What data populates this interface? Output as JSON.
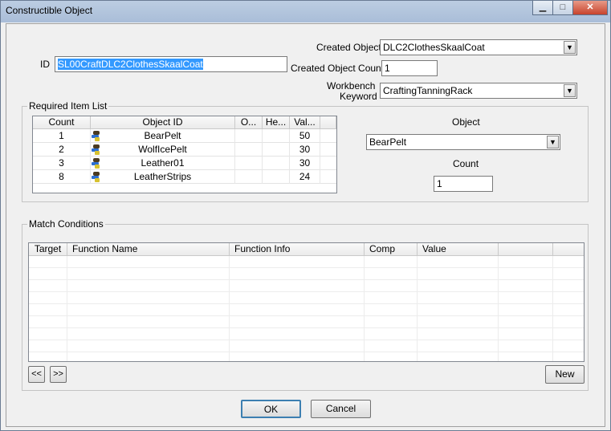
{
  "window": {
    "title": "Constructible Object"
  },
  "form": {
    "id_label": "ID",
    "id_value": "SL00CraftDLC2ClothesSkaalCoat",
    "created_object_label": "Created Object",
    "created_object_value": "DLC2ClothesSkaalCoat",
    "created_object_count_label": "Created Object Count",
    "created_object_count_value": "1",
    "workbench_label_line1": "Workbench",
    "workbench_label_line2": "Keyword",
    "workbench_value": "CraftingTanningRack"
  },
  "required_items": {
    "group_title": "Required Item List",
    "columns": [
      "Count",
      "Object ID",
      "O...",
      "He...",
      "Val..."
    ],
    "rows": [
      {
        "count": "1",
        "object_id": "BearPelt",
        "o": "",
        "he": "",
        "val": "50"
      },
      {
        "count": "2",
        "object_id": "WolfIcePelt",
        "o": "",
        "he": "",
        "val": "30"
      },
      {
        "count": "3",
        "object_id": "Leather01",
        "o": "",
        "he": "",
        "val": "30"
      },
      {
        "count": "8",
        "object_id": "LeatherStrips",
        "o": "",
        "he": "",
        "val": "24"
      }
    ],
    "object_label": "Object",
    "object_value": "BearPelt",
    "count_label": "Count",
    "count_value": "1"
  },
  "match_conditions": {
    "group_title": "Match Conditions",
    "columns": [
      "Target",
      "Function Name",
      "Function Info",
      "Comp",
      "Value",
      ""
    ],
    "prev_label": "<<",
    "next_label": ">>",
    "new_label": "New"
  },
  "buttons": {
    "ok": "OK",
    "cancel": "Cancel"
  },
  "icons": {
    "item": "item-icon",
    "minimize": "minimize-icon",
    "maximize": "maximize-icon",
    "close": "close-icon",
    "dropdown": "chevron-down-icon"
  }
}
